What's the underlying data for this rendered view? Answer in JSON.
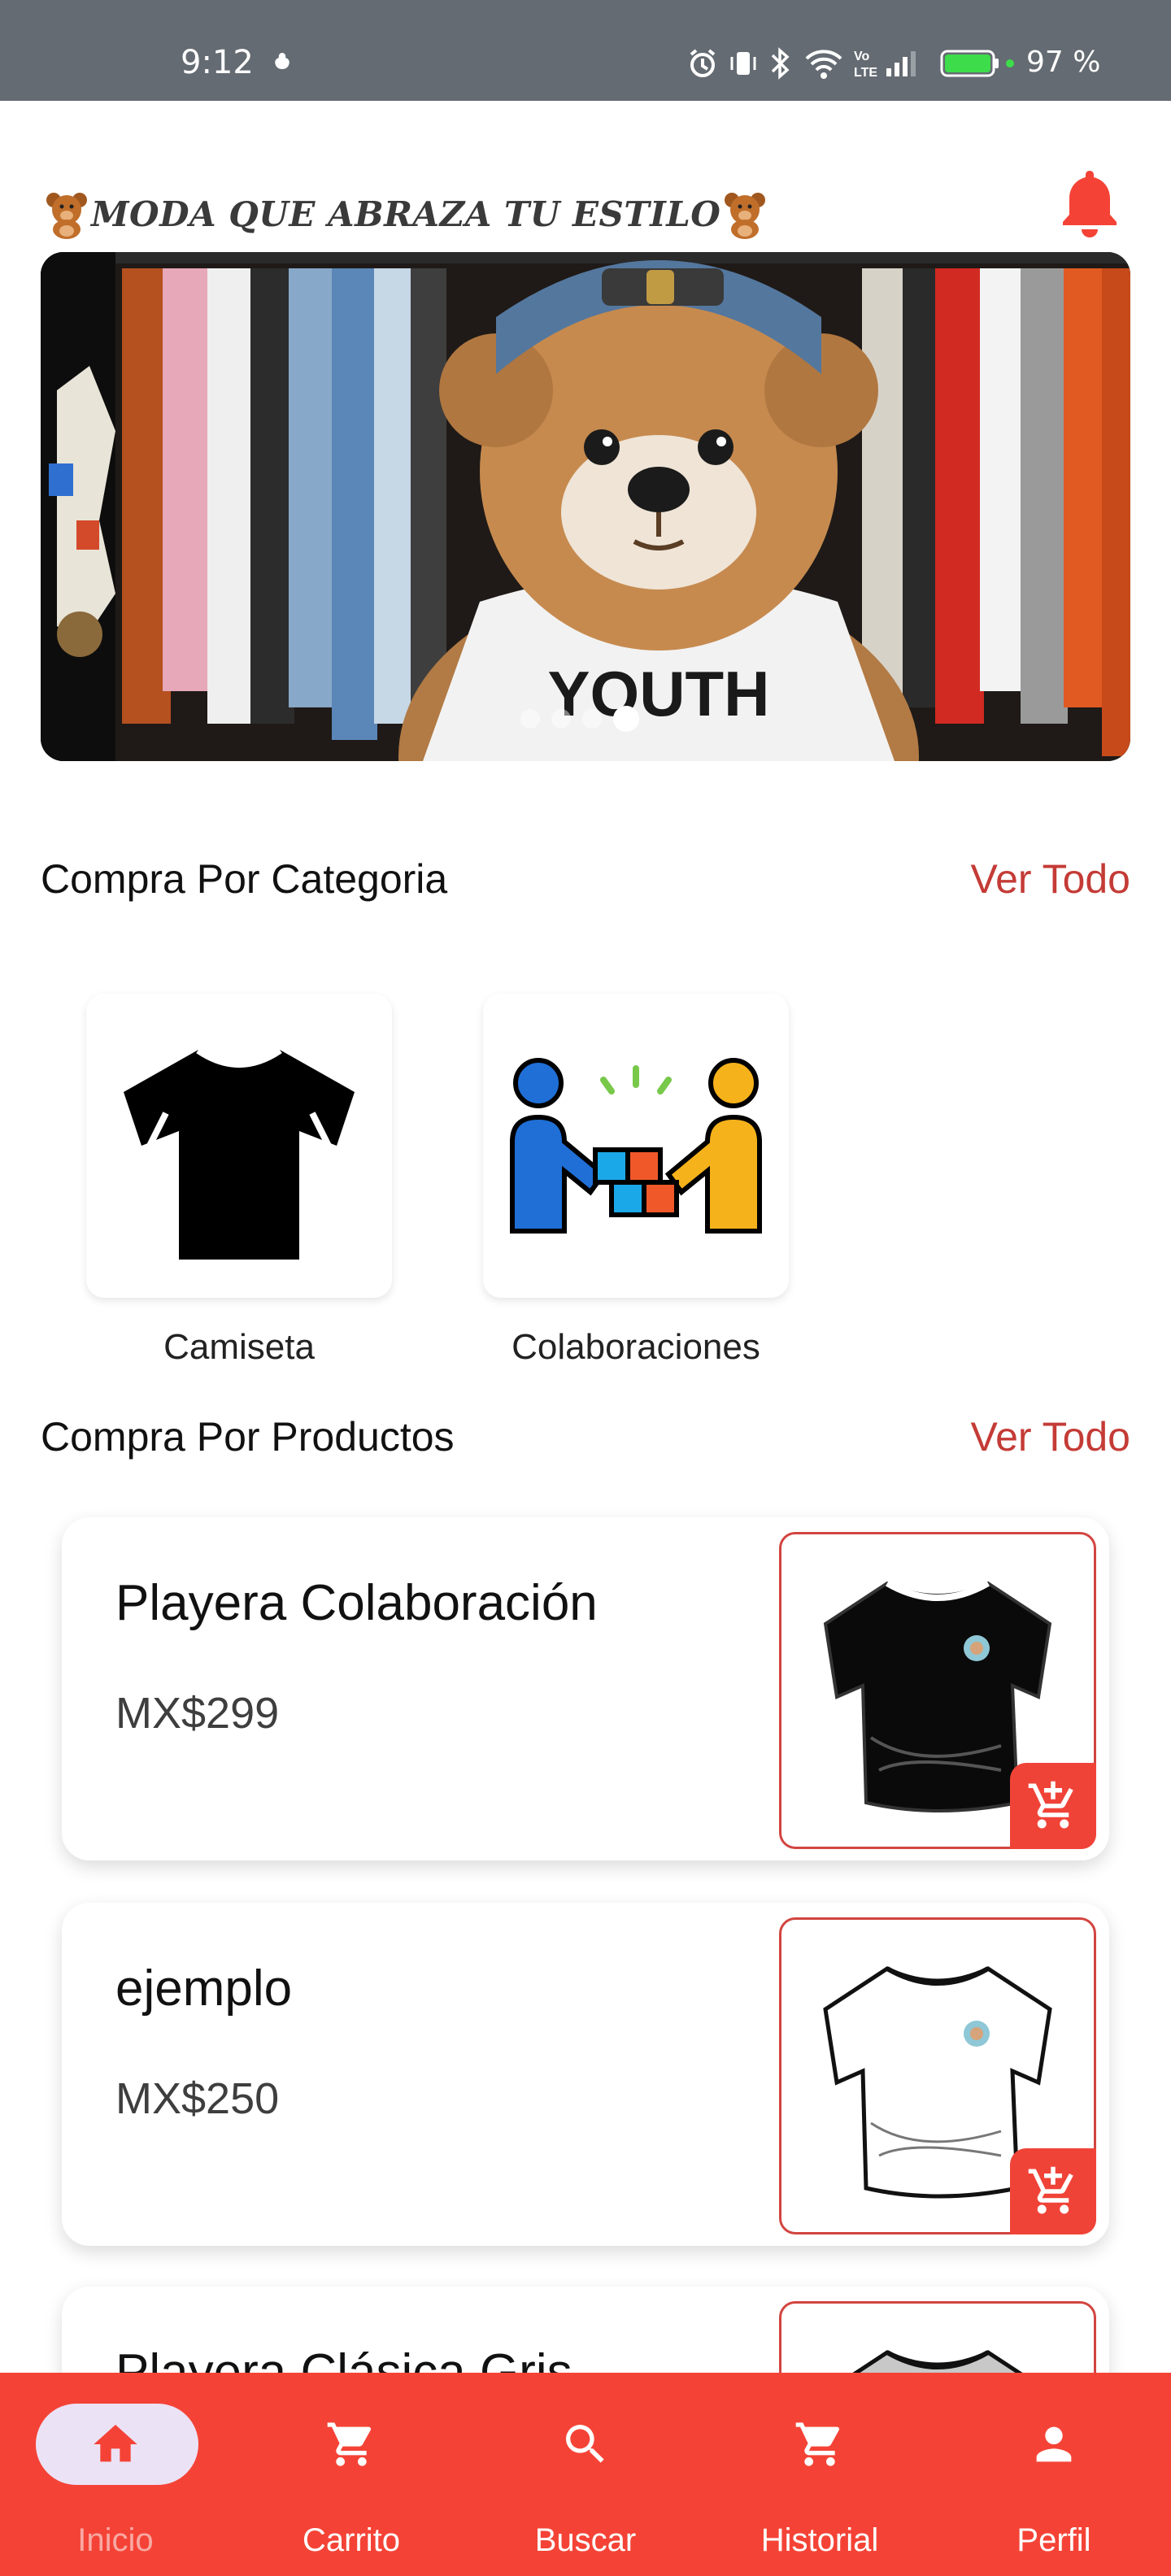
{
  "status_bar": {
    "time": "9:12",
    "battery": "97 %",
    "icons": [
      "alarm-icon",
      "vibrate-icon",
      "bluetooth-icon",
      "wifi-icon",
      "volte-icon",
      "signal-icon",
      "battery-icon"
    ]
  },
  "header": {
    "title": "MODA QUE ABRAZA TU ESTILO",
    "bell_icon": "bell-icon",
    "accent_color": "#f44336"
  },
  "hero": {
    "shirt_text": "YOUTH",
    "slides": 4,
    "active_slide": 4
  },
  "categories_section": {
    "title": "Compra Por Categoria",
    "see_all": "Ver Todo",
    "items": [
      {
        "label": "Camiseta",
        "icon": "tshirt-icon"
      },
      {
        "label": "Colaboraciones",
        "icon": "collaboration-icon"
      }
    ]
  },
  "products_section": {
    "title": "Compra Por Productos",
    "see_all": "Ver Todo",
    "items": [
      {
        "name": "Playera Colaboración",
        "price": "MX$299",
        "shirt_color": "black"
      },
      {
        "name": "ejemplo",
        "price": "MX$250",
        "shirt_color": "white"
      },
      {
        "name": "Playera Clásica Gris",
        "price": "",
        "shirt_color": "gray"
      }
    ]
  },
  "bottom_nav": {
    "items": [
      {
        "label": "Inicio",
        "icon": "home-icon",
        "active": true
      },
      {
        "label": "Carrito",
        "icon": "cart-icon",
        "active": false
      },
      {
        "label": "Buscar",
        "icon": "search-icon",
        "active": false
      },
      {
        "label": "Historial",
        "icon": "history-cart-icon",
        "active": false
      },
      {
        "label": "Perfil",
        "icon": "person-icon",
        "active": false
      }
    ]
  }
}
